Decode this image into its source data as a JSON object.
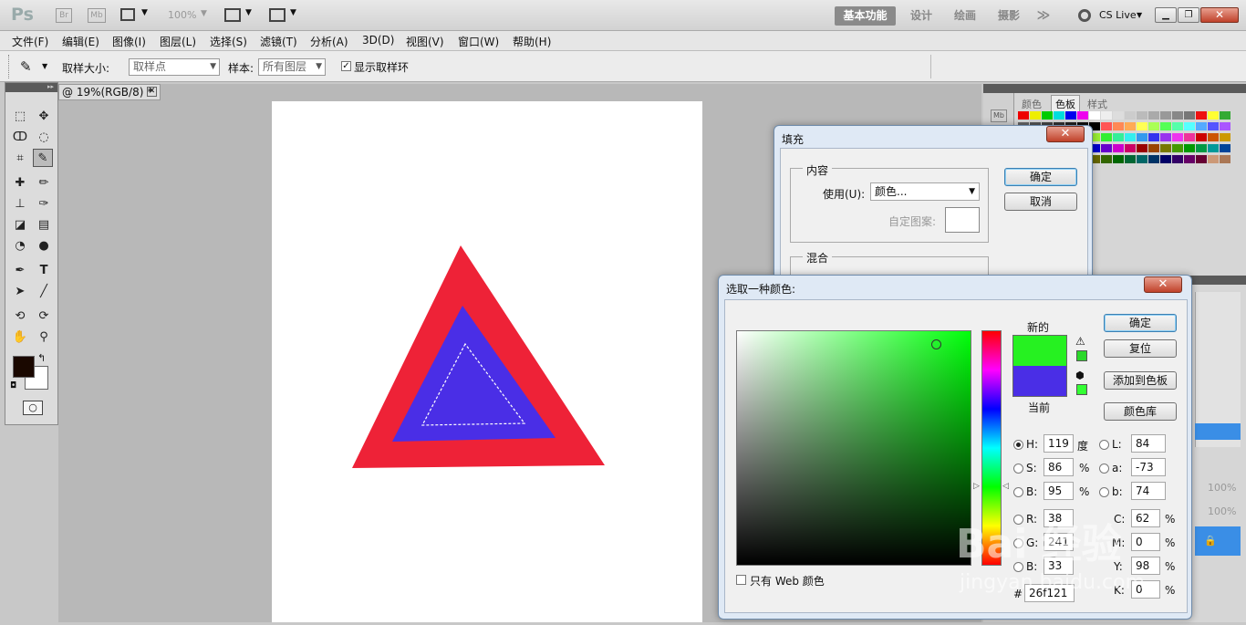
{
  "app": {
    "logo": "Ps",
    "zoom": "100%",
    "logo_btn1": "Br",
    "logo_btn2": "Mb"
  },
  "workspace": {
    "active": "基本功能",
    "items": [
      "设计",
      "绘画",
      "摄影"
    ],
    "more": "≫",
    "cs_live": "CS Live"
  },
  "menu": [
    "文件(F)",
    "编辑(E)",
    "图像(I)",
    "图层(L)",
    "选择(S)",
    "滤镜(T)",
    "分析(A)",
    "3D(D)",
    "视图(V)",
    "窗口(W)",
    "帮助(H)"
  ],
  "options": {
    "sample_size_label": "取样大小:",
    "sample_size_value": "取样点",
    "sample_label": "样本:",
    "sample_value": "所有图层",
    "show_ring_label": "显示取样环"
  },
  "document": {
    "tab_title": "@ 19%(RGB/8) *"
  },
  "panels": {
    "tabs": [
      "颜色",
      "色板",
      "样式"
    ],
    "active_tab": "色板",
    "opacity1": "100%",
    "opacity2": "100%"
  },
  "fill_dialog": {
    "title": "填充",
    "content_group": "内容",
    "use_label": "使用(U):",
    "use_value": "颜色...",
    "pattern_label": "自定图案:",
    "blend_group": "混合",
    "ok": "确定",
    "cancel": "取消"
  },
  "color_picker": {
    "title": "选取一种颜色:",
    "new_label": "新的",
    "current_label": "当前",
    "ok": "确定",
    "reset": "复位",
    "add_swatch": "添加到色板",
    "color_libraries": "颜色库",
    "only_web": "只有 Web 颜色",
    "new_color": "#26f121",
    "current_color": "#4a2ee6",
    "hsb": {
      "H": "119",
      "S": "86",
      "B": "95",
      "h_unit": "度",
      "pct": "%"
    },
    "rgb": {
      "R": "38",
      "G": "241",
      "B": "33"
    },
    "lab": {
      "L": "84",
      "a": "-73",
      "b": "74"
    },
    "cmyk": {
      "C": "62",
      "M": "0",
      "Y": "98",
      "K": "0"
    },
    "hex": "26f121",
    "hex_label": "#"
  },
  "watermark": {
    "text": "Bai 经验",
    "url": "jingyan.baidu.com"
  }
}
